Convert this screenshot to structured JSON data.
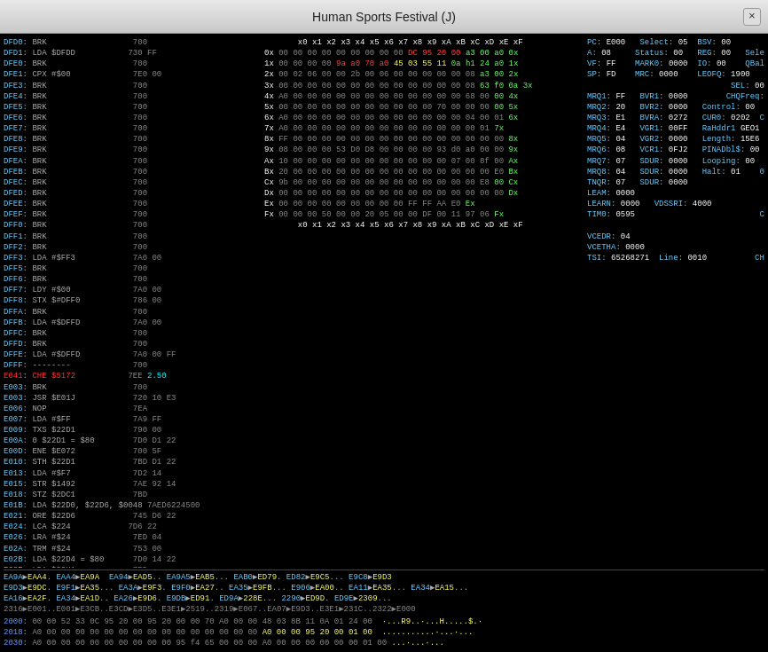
{
  "titleBar": {
    "title": "Human Sports Festival (J)",
    "closeLabel": "×"
  },
  "emulator": {
    "codePane": "code_content",
    "hexPane": "hex_content",
    "regPane": "reg_content"
  }
}
